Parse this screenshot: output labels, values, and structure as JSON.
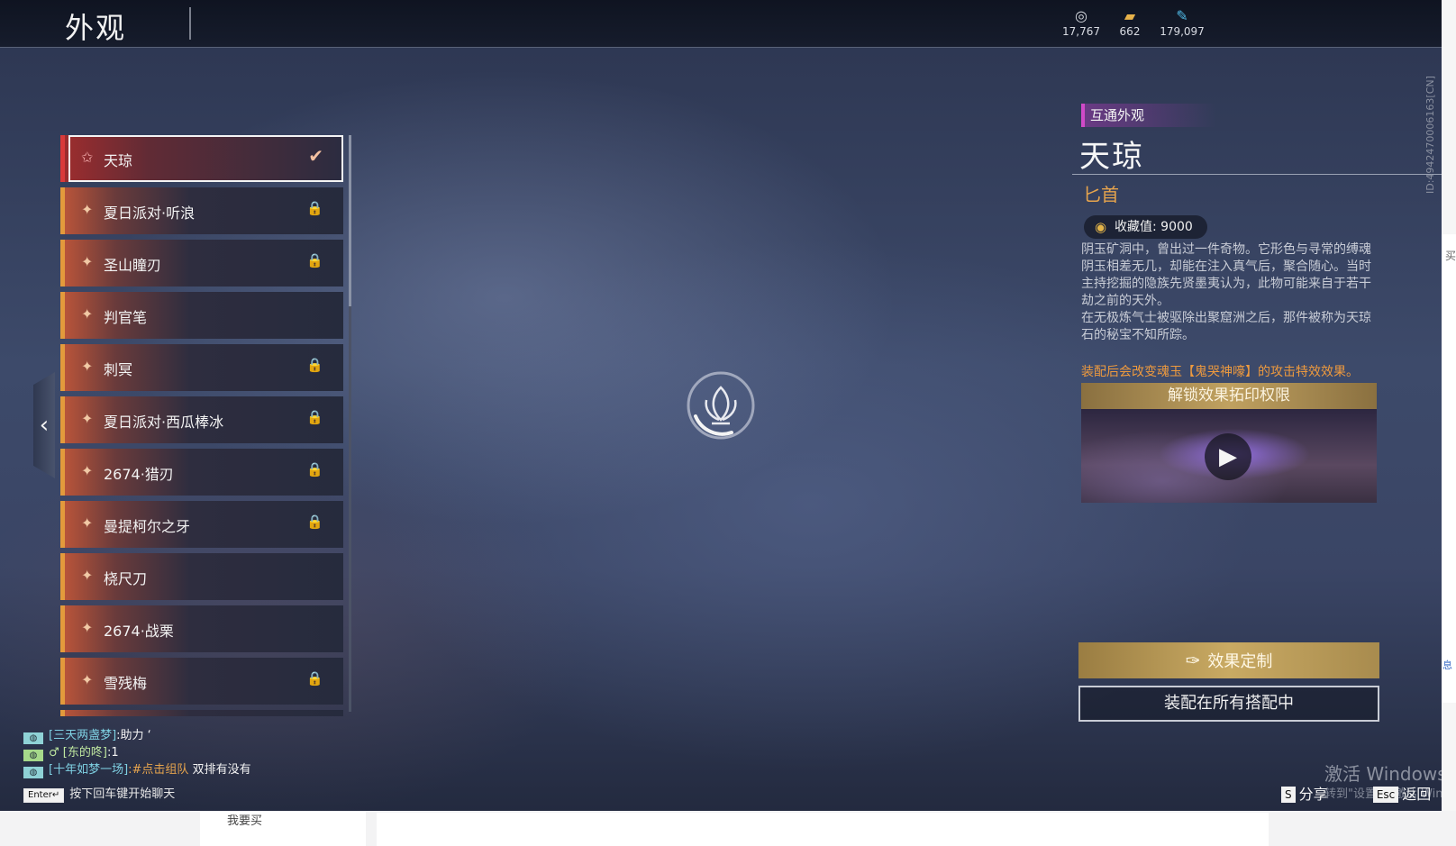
{
  "header": {
    "title": "外观",
    "currencies": [
      {
        "icon": "coin-icon",
        "value": "17,767"
      },
      {
        "icon": "ticket-icon",
        "value": "662"
      },
      {
        "icon": "feather-icon",
        "value": "179,097"
      }
    ]
  },
  "list": {
    "items": [
      {
        "label": "天琼",
        "status": "✔"
      },
      {
        "label": "夏日派对·听浪",
        "status": "🔒"
      },
      {
        "label": "圣山瞳刃",
        "status": "🔒"
      },
      {
        "label": "判官笔",
        "status": ""
      },
      {
        "label": "刺冥",
        "status": "🔒"
      },
      {
        "label": "夏日派对·西瓜棒冰",
        "status": "🔒"
      },
      {
        "label": "2674·猎刃",
        "status": "🔒"
      },
      {
        "label": "曼提柯尔之牙",
        "status": "🔒"
      },
      {
        "label": "桡尺刀",
        "status": ""
      },
      {
        "label": "2674·战栗",
        "status": ""
      },
      {
        "label": "雪残梅",
        "status": "🔒"
      }
    ]
  },
  "detail": {
    "tag": "互通外观",
    "name": "天琼",
    "type": "匕首",
    "collect": "收藏值: 9000",
    "desc": [
      "阴玉矿洞中，曾出过一件奇物。它形色与寻常的缚魂阴玉相差无几，却能在注入真气后，聚合随心。当时主持挖掘的隐族先贤墨夷认为，此物可能来自于若干劫之前的天外。",
      "在无极炼气士被驱除出聚窟洲之后，那件被称为天琼石的秘宝不知所踪。"
    ],
    "effect_note": "装配后会改变魂玉【鬼哭神嚎】的攻击特效效果。",
    "unlock_banner": "解锁效果拓印权限",
    "custom_button": "效果定制",
    "equip_button": "装配在所有搭配中",
    "uid": "ID:4942470006163[CN]"
  },
  "chat": {
    "lines": [
      {
        "name": "[三天两盏梦]",
        "msg": ":助力 ‘"
      },
      {
        "name": "♂ [东的咚]",
        "msg": ":1"
      },
      {
        "name": "[十年如梦一场]",
        "hot": ":#点击组队",
        "msg": " 双排有没有"
      }
    ],
    "hint_key": "Enter↵",
    "hint": "按下回车键开始聊天"
  },
  "bottom": {
    "share_key": "S",
    "share": "分享",
    "back_key": "Esc",
    "back": "返回"
  },
  "watermark": {
    "line1": "激活 Windows",
    "line2": "转到\"设置\"以激活 Windows。"
  },
  "browser": {
    "strip_text": "我要买",
    "edge1": "买",
    "edge2": "息"
  }
}
